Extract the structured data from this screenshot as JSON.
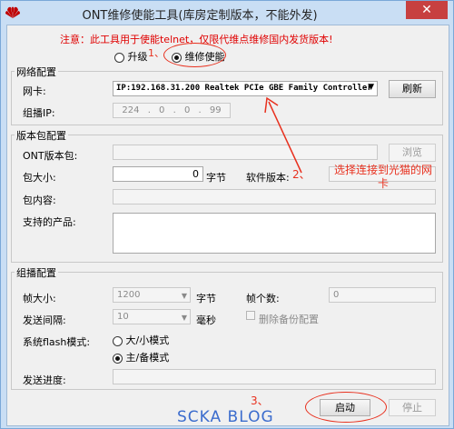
{
  "window": {
    "title": "ONT维修使能工具(库房定制版本，不能外发)",
    "close_glyph": "✕",
    "brand_color": "#c00000"
  },
  "notice": "注意：此工具用于使能telnet，仅限代维点维修国内发货版本!",
  "mode": {
    "upgrade_label": "升级",
    "repair_label": "维修使能",
    "selected": "repair"
  },
  "network": {
    "title": "网络配置",
    "nic_label": "网卡:",
    "nic_value": "IP:192.168.31.200 Realtek PCIe GBE Family Controller",
    "refresh_label": "刷新",
    "multicast_ip_label": "组播IP:",
    "multicast_ip_value": "224 . 0 . 0 . 99"
  },
  "package": {
    "title": "版本包配置",
    "ont_pkg_label": "ONT版本包:",
    "browse_label": "浏览",
    "size_label": "包大小:",
    "size_value": "0",
    "size_unit": "字节",
    "sw_version_label": "软件版本:",
    "content_label": "包内容:",
    "products_label": "支持的产品:"
  },
  "multicast": {
    "title": "组播配置",
    "frame_size_label": "帧大小:",
    "frame_size_value": "1200",
    "frame_size_unit": "字节",
    "frame_count_label": "帧个数:",
    "frame_count_value": "0",
    "interval_label": "发送间隔:",
    "interval_value": "10",
    "interval_unit": "毫秒",
    "delete_backup_label": "删除备份配置",
    "flash_mode_label": "系统flash模式:",
    "flash_small_label": "大/小模式",
    "flash_main_label": "主/备模式",
    "flash_selected": "main",
    "progress_label": "发送进度:",
    "progress": 0
  },
  "actions": {
    "start_label": "启动",
    "stop_label": "停止"
  },
  "annotations": {
    "mark1": "1、",
    "mark2": "2、",
    "mark2_text": "选择连接到光猫的网卡",
    "mark3": "3、",
    "color": "#e8301e"
  },
  "watermark": "SCKA BLOG"
}
